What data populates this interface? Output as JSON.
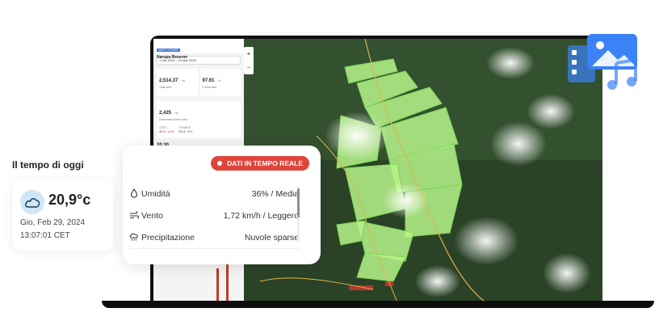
{
  "panel": {
    "tag": "MAPS VIEWER",
    "reserve_name": "Narupa Reserve",
    "date_range": "1 Jan 2021 - 15 Mar 2023",
    "total_area_value": "2,514.37",
    "total_area_unit": "ha",
    "total_area_label": "Total area",
    "forest_ratio_value": "97.61",
    "forest_ratio_unit": "%",
    "forest_ratio_label": "Forest ratio",
    "deforested_value": "2,425",
    "deforested_unit": "ha",
    "deforested_label": "Deforested forest area",
    "mini1_label": "COST",
    "mini1_value": "42.2",
    "mini1_delta": "-14%",
    "mini2_label": "CHANGE",
    "mini2_value": "25.3",
    "mini2_delta": "+8%",
    "cut_value": "20.30"
  },
  "zoom": {
    "plus": "+",
    "minus": "−"
  },
  "weather": {
    "title": "Il tempo di oggi",
    "temperature": "20,9°c",
    "date": "Gio, Feb 29, 2024",
    "time": "13:07:01 CET",
    "badge": "DATI IN TEMPO REALE",
    "rows": [
      {
        "icon": "humidity-drop-icon",
        "label": "Umidità",
        "value": "36% / Media"
      },
      {
        "icon": "wind-icon",
        "label": "Vento",
        "value": "1,72 km/h / Leggero"
      },
      {
        "icon": "rain-cloud-icon",
        "label": "Precipitazione",
        "value": "Nuvole sparse"
      }
    ]
  },
  "colors": {
    "badge": "#e0453c",
    "forest_polygons": "#b6f58a",
    "media_icon": "#3b82f6"
  }
}
